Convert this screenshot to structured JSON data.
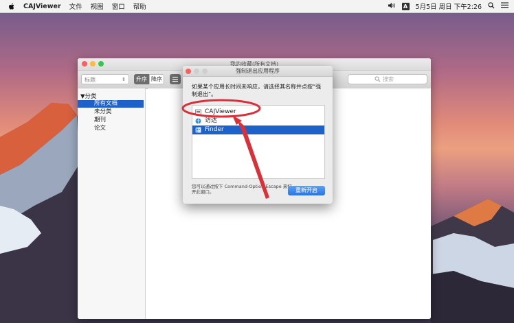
{
  "menubar": {
    "app_name": "CAJViewer",
    "menus": [
      "文件",
      "视图",
      "窗口",
      "帮助"
    ],
    "input_badge": "A",
    "datetime": "5月5日 周日 下午2:26"
  },
  "main_window": {
    "title": "我的收藏(所有文档)",
    "sort_field": "标题",
    "sort_asc_label": "升序",
    "sort_desc_label": "降序",
    "search_placeholder": "搜索",
    "sidebar": {
      "group": "▼分类",
      "items": [
        "所有文档",
        "未分类",
        "期刊",
        "论文"
      ],
      "selected_index": 0
    }
  },
  "force_quit": {
    "title": "强制退出应用程序",
    "instruction": "如果某个应用长时间未响应，请选择其名称并点按“强制退出”。",
    "apps": [
      "CAJViewer",
      "访达",
      "Finder"
    ],
    "selected_index": 2,
    "hint": "您可以通过按下 Command-Option-Escape 来打开此窗口。",
    "relaunch_label": "重新开启"
  },
  "colors": {
    "selection": "#1e62c9",
    "annotation": "#d9303a"
  }
}
